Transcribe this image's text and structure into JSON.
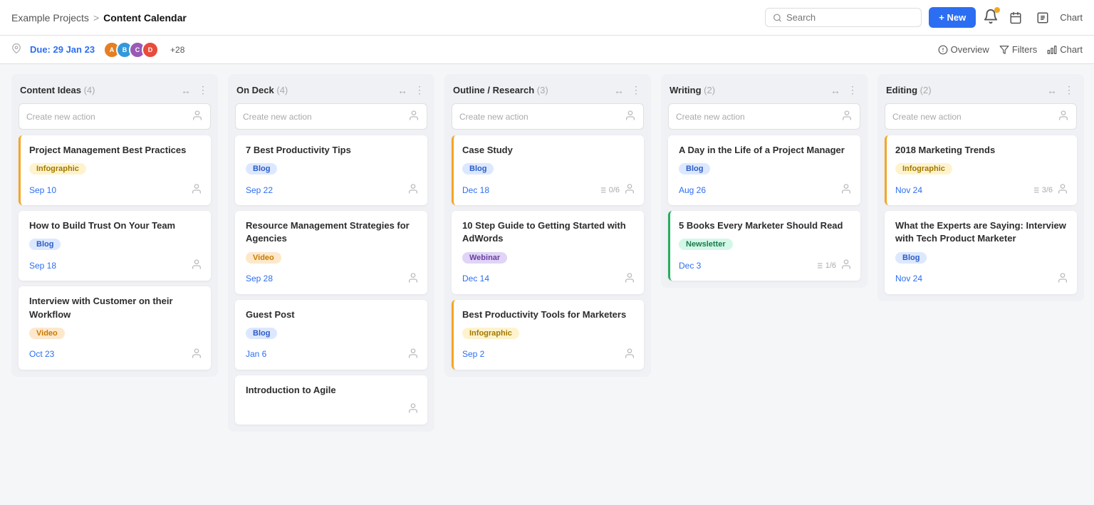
{
  "header": {
    "project": "Example Projects",
    "separator": ">",
    "page": "Content Calendar",
    "search_placeholder": "Search",
    "btn_new": "+ New"
  },
  "subheader": {
    "due_label": "Due: 29 Jan 23",
    "more_count": "+28",
    "overview": "Overview",
    "filters": "Filters",
    "chart": "Chart"
  },
  "columns": [
    {
      "id": "content-ideas",
      "title": "Content Ideas",
      "count": 4,
      "create_placeholder": "Create new action",
      "cards": [
        {
          "id": "c1",
          "title": "Project Management Best Practices",
          "tag": "Infographic",
          "tag_class": "tag-infographic",
          "date": "Sep 10",
          "border": "yellow-border"
        },
        {
          "id": "c2",
          "title": "How to Build Trust On Your Team",
          "tag": "Blog",
          "tag_class": "tag-blog",
          "date": "Sep 18",
          "border": ""
        },
        {
          "id": "c3",
          "title": "Interview with Customer on their Workflow",
          "tag": "Video",
          "tag_class": "tag-video",
          "date": "Oct 23",
          "border": ""
        }
      ]
    },
    {
      "id": "on-deck",
      "title": "On Deck",
      "count": 4,
      "create_placeholder": "Create new action",
      "cards": [
        {
          "id": "d1",
          "title": "7 Best Productivity Tips",
          "tag": "Blog",
          "tag_class": "tag-blog",
          "date": "Sep 22",
          "border": ""
        },
        {
          "id": "d2",
          "title": "Resource Management Strategies for Agencies",
          "tag": "Video",
          "tag_class": "tag-video",
          "date": "Sep 28",
          "border": ""
        },
        {
          "id": "d3",
          "title": "Guest Post",
          "tag": "Blog",
          "tag_class": "tag-blog",
          "date": "Jan 6",
          "border": ""
        },
        {
          "id": "d4",
          "title": "Introduction to Agile",
          "tag": "",
          "tag_class": "",
          "date": "",
          "border": ""
        }
      ]
    },
    {
      "id": "outline-research",
      "title": "Outline / Research",
      "count": 3,
      "create_placeholder": "Create new action",
      "cards": [
        {
          "id": "o1",
          "title": "Case Study",
          "tag": "Blog",
          "tag_class": "tag-blog",
          "date": "Dec 18",
          "subtasks": "0/6",
          "border": "yellow-border"
        },
        {
          "id": "o2",
          "title": "10 Step Guide to Getting Started with AdWords",
          "tag": "Webinar",
          "tag_class": "tag-webinar",
          "date": "Dec 14",
          "border": ""
        },
        {
          "id": "o3",
          "title": "Best Productivity Tools for Marketers",
          "tag": "Infographic",
          "tag_class": "tag-infographic",
          "date": "Sep 2",
          "border": "yellow-border"
        }
      ]
    },
    {
      "id": "writing",
      "title": "Writing",
      "count": 2,
      "create_placeholder": "Create new action",
      "cards": [
        {
          "id": "w1",
          "title": "A Day in the Life of a Project Manager",
          "tag": "Blog",
          "tag_class": "tag-blog",
          "date": "Aug 26",
          "border": ""
        },
        {
          "id": "w2",
          "title": "5 Books Every Marketer Should Read",
          "tag": "Newsletter",
          "tag_class": "tag-newsletter",
          "date": "Dec 3",
          "subtasks": "1/6",
          "border": "green-border"
        }
      ]
    },
    {
      "id": "editing",
      "title": "Editing",
      "count": 2,
      "create_placeholder": "Create new action",
      "cards": [
        {
          "id": "e1",
          "title": "2018 Marketing Trends",
          "tag": "Infographic",
          "tag_class": "tag-infographic",
          "date": "Nov 24",
          "subtasks": "3/6",
          "border": "yellow-border"
        },
        {
          "id": "e2",
          "title": "What the Experts are Saying: Interview with Tech Product Marketer",
          "tag": "Blog",
          "tag_class": "tag-blog",
          "date": "Nov 24",
          "border": ""
        }
      ]
    }
  ],
  "avatars": [
    {
      "color": "#e67e22",
      "initial": "A"
    },
    {
      "color": "#3498db",
      "initial": "B"
    },
    {
      "color": "#9b59b6",
      "initial": "C"
    },
    {
      "color": "#e74c3c",
      "initial": "D"
    }
  ]
}
